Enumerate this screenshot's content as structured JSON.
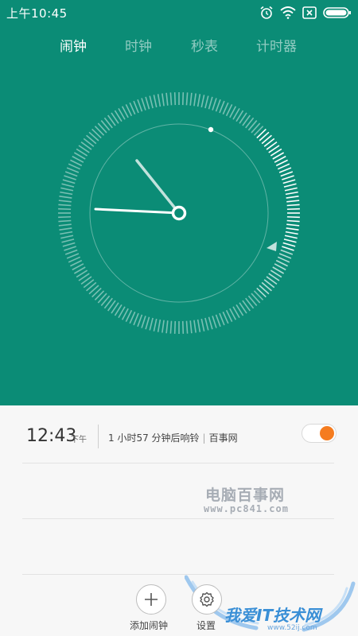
{
  "status_bar": {
    "time": "上午10:45",
    "icons": [
      "alarm-clock-icon",
      "wifi-icon",
      "sim-no-signal-icon",
      "battery-icon"
    ]
  },
  "tabs": [
    {
      "label": "闹钟",
      "active": true
    },
    {
      "label": "时钟",
      "active": false
    },
    {
      "label": "秒表",
      "active": false
    },
    {
      "label": "计时器",
      "active": false
    }
  ],
  "colors": {
    "header_bg": "#0b8c76",
    "toggle_on": "#f57c1f"
  },
  "alarm": {
    "time": "12:43",
    "ampm": "下午",
    "countdown": "1 小时57 分钟后响铃",
    "label": "百事网",
    "enabled": true
  },
  "watermark": {
    "title": "电脑百事网",
    "url": "www.pc841.com"
  },
  "actions": {
    "add_label": "添加闹钟",
    "settings_label": "设置"
  },
  "footer_logo": {
    "text": "我爱IT技术网",
    "url": "www.52ij.com"
  }
}
